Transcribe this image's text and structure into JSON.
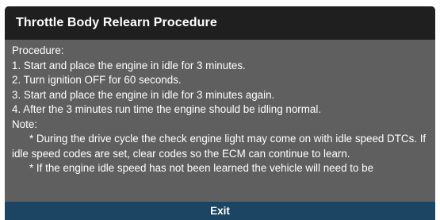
{
  "dialog": {
    "title": "Throttle Body Relearn Procedure",
    "procedure_heading": "Procedure:",
    "steps": [
      "1. Start and place the engine in idle for 3 minutes.",
      "2. Turn ignition OFF for 60 seconds.",
      "3. Start and place the engine in idle for 3 minutes again.",
      "4. After the 3 minutes run time the engine should be idling normal."
    ],
    "note_heading": "Note:",
    "notes": [
      "* During the drive cycle the check engine light may come on with idle speed DTCs. If idle speed codes are set, clear codes so the ECM can continue to learn.",
      "* If the engine idle speed has not been learned the vehicle will need to be"
    ],
    "exit_label": "Exit"
  },
  "colors": {
    "title_bar": "#1f1f1f",
    "body_background": "#5f5f5f",
    "exit_bar": "#1c4563",
    "text": "#ffffff"
  }
}
